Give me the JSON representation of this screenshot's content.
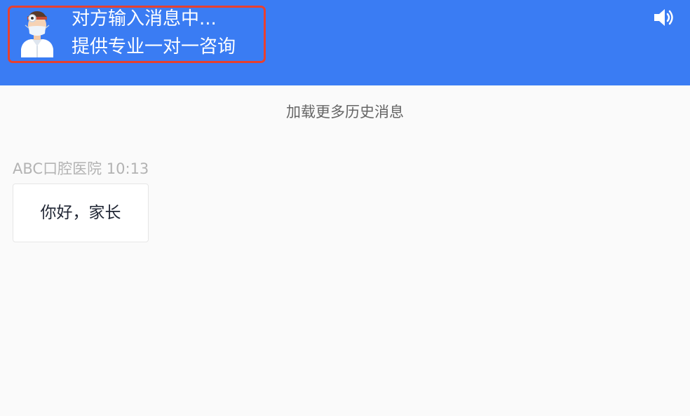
{
  "colors": {
    "header_bg": "#3a7cf3",
    "highlight_border": "#e8402e",
    "page_bg": "#fafafa",
    "meta_text": "#b3b3b3",
    "bubble_text": "#1f2533"
  },
  "header": {
    "status": "对方输入消息中...",
    "subtitle": "提供专业一对一咨询",
    "avatar_icon": "doctor-avatar-icon",
    "sound_icon": "speaker-volume-icon"
  },
  "chat": {
    "load_more": "加载更多历史消息",
    "messages": [
      {
        "sender": "ABC口腔医院",
        "time": "10:13",
        "text": "你好，家长"
      }
    ]
  }
}
